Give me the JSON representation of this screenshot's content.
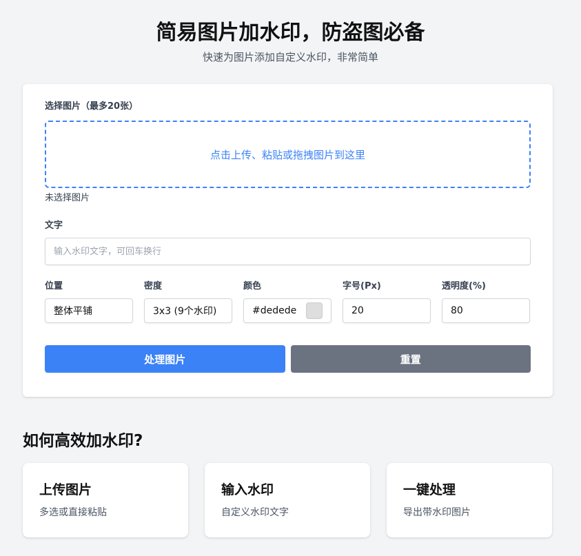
{
  "header": {
    "title": "简易图片加水印，防盗图必备",
    "subtitle": "快速为图片添加自定义水印，非常简单"
  },
  "upload": {
    "label": "选择图片（最多20张）",
    "dropzone_text": "点击上传、粘贴或拖拽图片到这里",
    "status": "未选择图片"
  },
  "text": {
    "label": "文字",
    "placeholder": "输入水印文字，可回车换行",
    "value": ""
  },
  "options": {
    "position": {
      "label": "位置",
      "value": "整体平铺"
    },
    "density": {
      "label": "密度",
      "value": "3x3 (9个水印)"
    },
    "color": {
      "label": "颜色",
      "value": "#dedede",
      "swatch": "#dedede"
    },
    "font_size": {
      "label": "字号(Px)",
      "value": "20"
    },
    "opacity": {
      "label": "透明度(%)",
      "value": "80"
    }
  },
  "buttons": {
    "process": "处理图片",
    "reset": "重置"
  },
  "colors": {
    "primary": "#3b82f6",
    "secondary": "#6b7280",
    "background": "#f3f4f6"
  },
  "howto": {
    "title": "如何高效加水印?",
    "steps": [
      {
        "title": "上传图片",
        "desc": "多选或直接粘贴"
      },
      {
        "title": "输入水印",
        "desc": "自定义水印文字"
      },
      {
        "title": "一键处理",
        "desc": "导出带水印图片"
      }
    ]
  }
}
